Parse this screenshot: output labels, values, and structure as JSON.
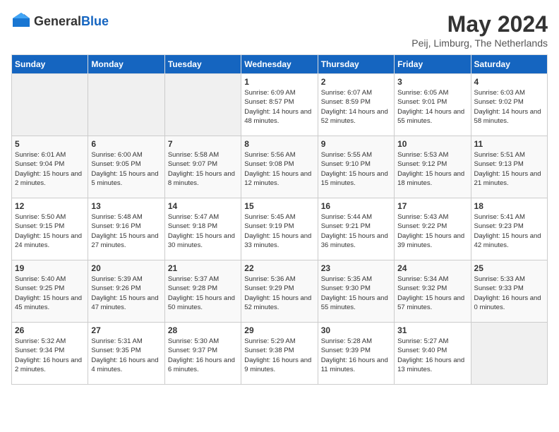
{
  "logo": {
    "general": "General",
    "blue": "Blue"
  },
  "title": "May 2024",
  "subtitle": "Peij, Limburg, The Netherlands",
  "weekdays": [
    "Sunday",
    "Monday",
    "Tuesday",
    "Wednesday",
    "Thursday",
    "Friday",
    "Saturday"
  ],
  "weeks": [
    [
      {
        "day": "",
        "sunrise": "",
        "sunset": "",
        "daylight": ""
      },
      {
        "day": "",
        "sunrise": "",
        "sunset": "",
        "daylight": ""
      },
      {
        "day": "",
        "sunrise": "",
        "sunset": "",
        "daylight": ""
      },
      {
        "day": "1",
        "sunrise": "Sunrise: 6:09 AM",
        "sunset": "Sunset: 8:57 PM",
        "daylight": "Daylight: 14 hours and 48 minutes."
      },
      {
        "day": "2",
        "sunrise": "Sunrise: 6:07 AM",
        "sunset": "Sunset: 8:59 PM",
        "daylight": "Daylight: 14 hours and 52 minutes."
      },
      {
        "day": "3",
        "sunrise": "Sunrise: 6:05 AM",
        "sunset": "Sunset: 9:01 PM",
        "daylight": "Daylight: 14 hours and 55 minutes."
      },
      {
        "day": "4",
        "sunrise": "Sunrise: 6:03 AM",
        "sunset": "Sunset: 9:02 PM",
        "daylight": "Daylight: 14 hours and 58 minutes."
      }
    ],
    [
      {
        "day": "5",
        "sunrise": "Sunrise: 6:01 AM",
        "sunset": "Sunset: 9:04 PM",
        "daylight": "Daylight: 15 hours and 2 minutes."
      },
      {
        "day": "6",
        "sunrise": "Sunrise: 6:00 AM",
        "sunset": "Sunset: 9:05 PM",
        "daylight": "Daylight: 15 hours and 5 minutes."
      },
      {
        "day": "7",
        "sunrise": "Sunrise: 5:58 AM",
        "sunset": "Sunset: 9:07 PM",
        "daylight": "Daylight: 15 hours and 8 minutes."
      },
      {
        "day": "8",
        "sunrise": "Sunrise: 5:56 AM",
        "sunset": "Sunset: 9:08 PM",
        "daylight": "Daylight: 15 hours and 12 minutes."
      },
      {
        "day": "9",
        "sunrise": "Sunrise: 5:55 AM",
        "sunset": "Sunset: 9:10 PM",
        "daylight": "Daylight: 15 hours and 15 minutes."
      },
      {
        "day": "10",
        "sunrise": "Sunrise: 5:53 AM",
        "sunset": "Sunset: 9:12 PM",
        "daylight": "Daylight: 15 hours and 18 minutes."
      },
      {
        "day": "11",
        "sunrise": "Sunrise: 5:51 AM",
        "sunset": "Sunset: 9:13 PM",
        "daylight": "Daylight: 15 hours and 21 minutes."
      }
    ],
    [
      {
        "day": "12",
        "sunrise": "Sunrise: 5:50 AM",
        "sunset": "Sunset: 9:15 PM",
        "daylight": "Daylight: 15 hours and 24 minutes."
      },
      {
        "day": "13",
        "sunrise": "Sunrise: 5:48 AM",
        "sunset": "Sunset: 9:16 PM",
        "daylight": "Daylight: 15 hours and 27 minutes."
      },
      {
        "day": "14",
        "sunrise": "Sunrise: 5:47 AM",
        "sunset": "Sunset: 9:18 PM",
        "daylight": "Daylight: 15 hours and 30 minutes."
      },
      {
        "day": "15",
        "sunrise": "Sunrise: 5:45 AM",
        "sunset": "Sunset: 9:19 PM",
        "daylight": "Daylight: 15 hours and 33 minutes."
      },
      {
        "day": "16",
        "sunrise": "Sunrise: 5:44 AM",
        "sunset": "Sunset: 9:21 PM",
        "daylight": "Daylight: 15 hours and 36 minutes."
      },
      {
        "day": "17",
        "sunrise": "Sunrise: 5:43 AM",
        "sunset": "Sunset: 9:22 PM",
        "daylight": "Daylight: 15 hours and 39 minutes."
      },
      {
        "day": "18",
        "sunrise": "Sunrise: 5:41 AM",
        "sunset": "Sunset: 9:23 PM",
        "daylight": "Daylight: 15 hours and 42 minutes."
      }
    ],
    [
      {
        "day": "19",
        "sunrise": "Sunrise: 5:40 AM",
        "sunset": "Sunset: 9:25 PM",
        "daylight": "Daylight: 15 hours and 45 minutes."
      },
      {
        "day": "20",
        "sunrise": "Sunrise: 5:39 AM",
        "sunset": "Sunset: 9:26 PM",
        "daylight": "Daylight: 15 hours and 47 minutes."
      },
      {
        "day": "21",
        "sunrise": "Sunrise: 5:37 AM",
        "sunset": "Sunset: 9:28 PM",
        "daylight": "Daylight: 15 hours and 50 minutes."
      },
      {
        "day": "22",
        "sunrise": "Sunrise: 5:36 AM",
        "sunset": "Sunset: 9:29 PM",
        "daylight": "Daylight: 15 hours and 52 minutes."
      },
      {
        "day": "23",
        "sunrise": "Sunrise: 5:35 AM",
        "sunset": "Sunset: 9:30 PM",
        "daylight": "Daylight: 15 hours and 55 minutes."
      },
      {
        "day": "24",
        "sunrise": "Sunrise: 5:34 AM",
        "sunset": "Sunset: 9:32 PM",
        "daylight": "Daylight: 15 hours and 57 minutes."
      },
      {
        "day": "25",
        "sunrise": "Sunrise: 5:33 AM",
        "sunset": "Sunset: 9:33 PM",
        "daylight": "Daylight: 16 hours and 0 minutes."
      }
    ],
    [
      {
        "day": "26",
        "sunrise": "Sunrise: 5:32 AM",
        "sunset": "Sunset: 9:34 PM",
        "daylight": "Daylight: 16 hours and 2 minutes."
      },
      {
        "day": "27",
        "sunrise": "Sunrise: 5:31 AM",
        "sunset": "Sunset: 9:35 PM",
        "daylight": "Daylight: 16 hours and 4 minutes."
      },
      {
        "day": "28",
        "sunrise": "Sunrise: 5:30 AM",
        "sunset": "Sunset: 9:37 PM",
        "daylight": "Daylight: 16 hours and 6 minutes."
      },
      {
        "day": "29",
        "sunrise": "Sunrise: 5:29 AM",
        "sunset": "Sunset: 9:38 PM",
        "daylight": "Daylight: 16 hours and 9 minutes."
      },
      {
        "day": "30",
        "sunrise": "Sunrise: 5:28 AM",
        "sunset": "Sunset: 9:39 PM",
        "daylight": "Daylight: 16 hours and 11 minutes."
      },
      {
        "day": "31",
        "sunrise": "Sunrise: 5:27 AM",
        "sunset": "Sunset: 9:40 PM",
        "daylight": "Daylight: 16 hours and 13 minutes."
      },
      {
        "day": "",
        "sunrise": "",
        "sunset": "",
        "daylight": ""
      }
    ]
  ]
}
